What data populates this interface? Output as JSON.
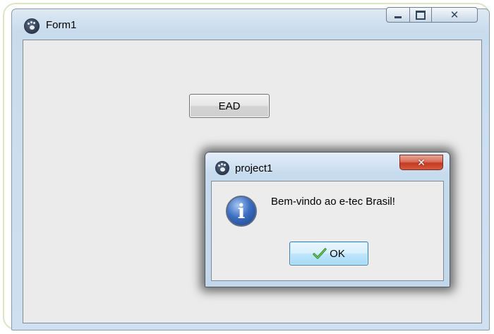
{
  "form1": {
    "title": "Form1",
    "icon": "paw-app-icon",
    "buttons": {
      "ead_label": "EAD"
    }
  },
  "dialog": {
    "title": "project1",
    "icon": "paw-app-icon",
    "message": "Bem-vindo ao e-tec Brasil!",
    "message_icon": "info-icon",
    "ok_label": "OK",
    "ok_icon": "checkmark-icon"
  },
  "colors": {
    "dialog_close": "#c8402a",
    "ok_button": "#bee6fd",
    "frame_border": "#d9e6c3"
  }
}
